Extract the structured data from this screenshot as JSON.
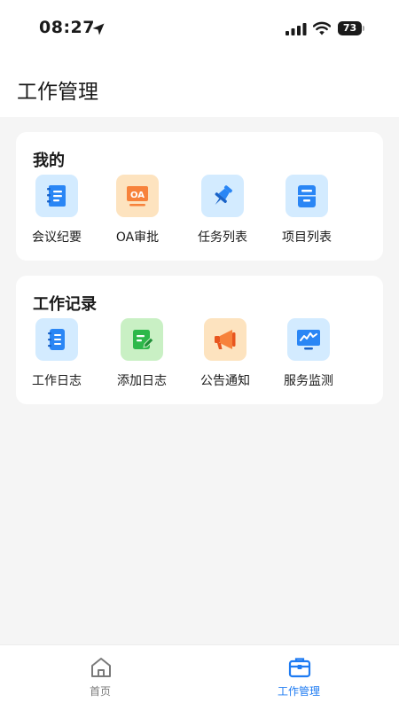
{
  "status_bar": {
    "time": "08:27",
    "battery": "73"
  },
  "header": {
    "title": "工作管理"
  },
  "sections": [
    {
      "title": "我的",
      "items": [
        {
          "label": "会议纪要",
          "icon": "meeting-notes-icon"
        },
        {
          "label": "OA审批",
          "icon": "oa-approval-icon",
          "icon_text": "OA"
        },
        {
          "label": "任务列表",
          "icon": "pin-icon"
        },
        {
          "label": "项目列表",
          "icon": "project-cabinet-icon"
        }
      ]
    },
    {
      "title": "工作记录",
      "items": [
        {
          "label": "工作日志",
          "icon": "notebook-icon"
        },
        {
          "label": "添加日志",
          "icon": "add-log-icon"
        },
        {
          "label": "公告通知",
          "icon": "megaphone-icon"
        },
        {
          "label": "服务监测",
          "icon": "monitor-icon"
        }
      ]
    }
  ],
  "tabbar": {
    "items": [
      {
        "label": "首页",
        "icon": "home-icon",
        "active": false
      },
      {
        "label": "工作管理",
        "icon": "briefcase-icon",
        "active": true
      }
    ]
  },
  "colors": {
    "accent": "#1e7bf2",
    "inactive_tab": "#7a7a7a",
    "page_background": "#f5f5f5"
  }
}
